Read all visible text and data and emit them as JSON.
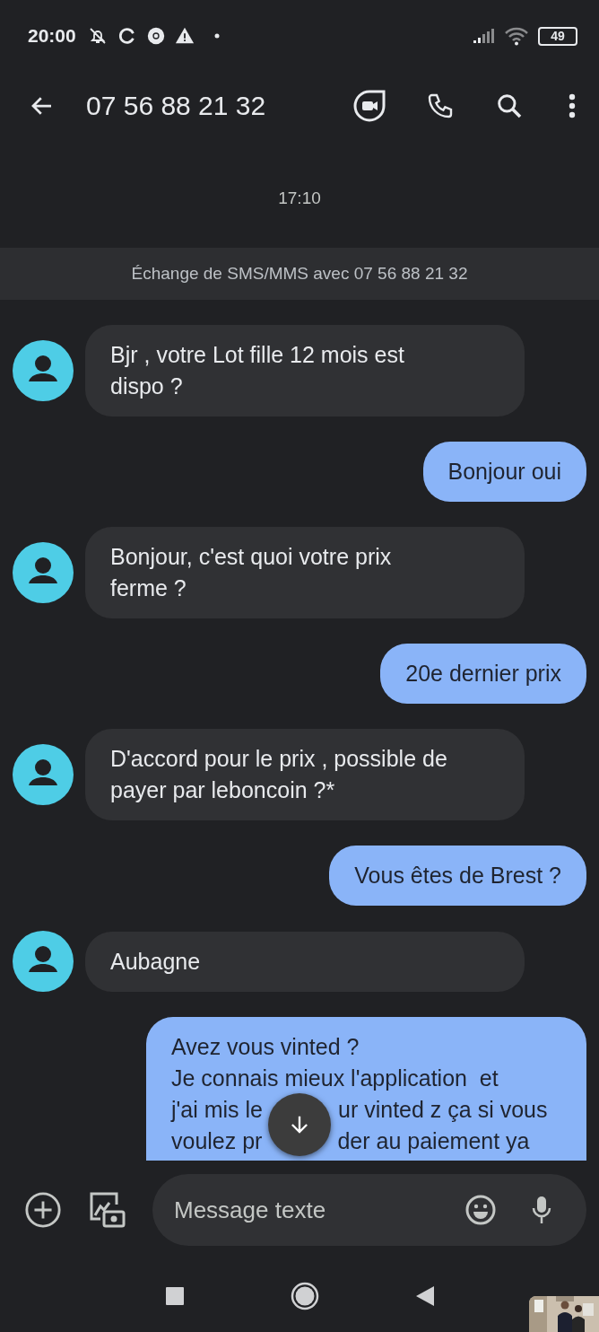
{
  "status_bar": {
    "time": "20:00",
    "battery": "49"
  },
  "header": {
    "title": "07 56 88 21 32"
  },
  "timestamp": "17:10",
  "banner": "Échange de SMS/MMS avec 07 56 88 21 32",
  "messages": [
    {
      "kind": "incoming",
      "lines": [
        [
          "Bjr , votre Lot fille 12 mois est"
        ],
        [
          "dispo ?"
        ]
      ]
    },
    {
      "kind": "outgoing",
      "lines": [
        [
          "Bonjour oui"
        ]
      ]
    },
    {
      "kind": "incoming",
      "lines": [
        [
          "Bonjour, c'est quoi votre prix"
        ],
        [
          "ferme ?"
        ]
      ]
    },
    {
      "kind": "outgoing",
      "lines": [
        [
          "20e dernier prix"
        ]
      ]
    },
    {
      "kind": "incoming",
      "lines": [
        [
          "D'accord pour le prix , possible de"
        ],
        [
          "payer par leboncoin ?*"
        ]
      ]
    },
    {
      "kind": "outgoing",
      "lines": [
        [
          "Vous êtes de Brest ?"
        ]
      ]
    },
    {
      "kind": "incoming",
      "lines": [
        [
          "Aubagne"
        ]
      ]
    },
    {
      "kind": "outgoing",
      "lines": [
        [
          "Avez vous vinted ?"
        ],
        [
          "Je connais mieux l'application  et"
        ],
        [
          "j'ai mis le",
          "ur vinted z ça si vous"
        ],
        [
          "voulez pr",
          "der au paiement ya"
        ]
      ]
    }
  ],
  "composer": {
    "placeholder": "Message texte"
  }
}
